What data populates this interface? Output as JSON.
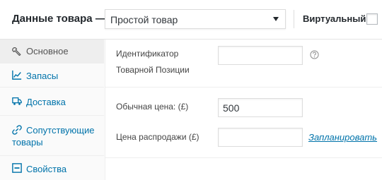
{
  "header": {
    "title": "Данные товара —",
    "product_type": {
      "selected": "Простой товар"
    },
    "virtual_label": "Виртуальный:"
  },
  "tabs": [
    {
      "label": "Основное",
      "icon": "wrench-icon",
      "active": true
    },
    {
      "label": "Запасы",
      "icon": "chart-icon",
      "active": false
    },
    {
      "label": "Доставка",
      "icon": "truck-icon",
      "active": false
    },
    {
      "label_line1": "Сопутствующие",
      "label_line2": "товары",
      "icon": "link-icon",
      "active": false
    },
    {
      "label": "Свойства",
      "icon": "list-icon",
      "active": false
    }
  ],
  "general": {
    "sku_label_line1": "Идентификатор",
    "sku_label_line2": "Товарной Позиции",
    "sku_value": "",
    "regular_price_label": "Обычная цена: (£)",
    "regular_price_value": "500",
    "sale_price_label": "Цена распродажи (£)",
    "sale_price_value": "",
    "schedule_link": "Запланировать"
  },
  "colors": {
    "link": "#0073aa",
    "active_tab_bg": "#eeeeee",
    "tab_bg": "#fafafa"
  }
}
